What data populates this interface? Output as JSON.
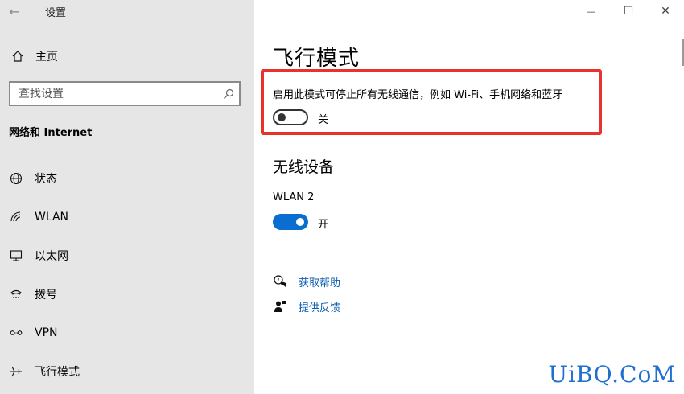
{
  "window": {
    "title": "设置",
    "back_glyph": "←",
    "minimize_glyph": "—",
    "maximize_glyph": "☐",
    "close_glyph": "✕"
  },
  "sidebar": {
    "home_label": "主页",
    "search_placeholder": "查找设置",
    "section_title": "网络和 Internet",
    "items": [
      {
        "label": "状态",
        "icon": "globe-icon"
      },
      {
        "label": "WLAN",
        "icon": "wifi-icon"
      },
      {
        "label": "以太网",
        "icon": "ethernet-icon"
      },
      {
        "label": "拨号",
        "icon": "dialup-icon"
      },
      {
        "label": "VPN",
        "icon": "vpn-icon"
      },
      {
        "label": "飞行模式",
        "icon": "airplane-icon"
      }
    ]
  },
  "main": {
    "title": "飞行模式",
    "airplane_desc": "启用此模式可停止所有无线通信，例如 Wi-Fi、手机网络和蓝牙",
    "airplane_state_label": "关",
    "airplane_on": false,
    "wireless_heading": "无线设备",
    "device_name": "WLAN 2",
    "device_state_label": "开",
    "device_on": true,
    "help_link": "获取帮助",
    "feedback_link": "提供反馈"
  },
  "watermark": "UiBQ.CoM",
  "colors": {
    "accent": "#0a6ed1",
    "highlight": "#e8322e",
    "sidebar_bg": "#e6e6e6",
    "link": "#0a5db0"
  }
}
